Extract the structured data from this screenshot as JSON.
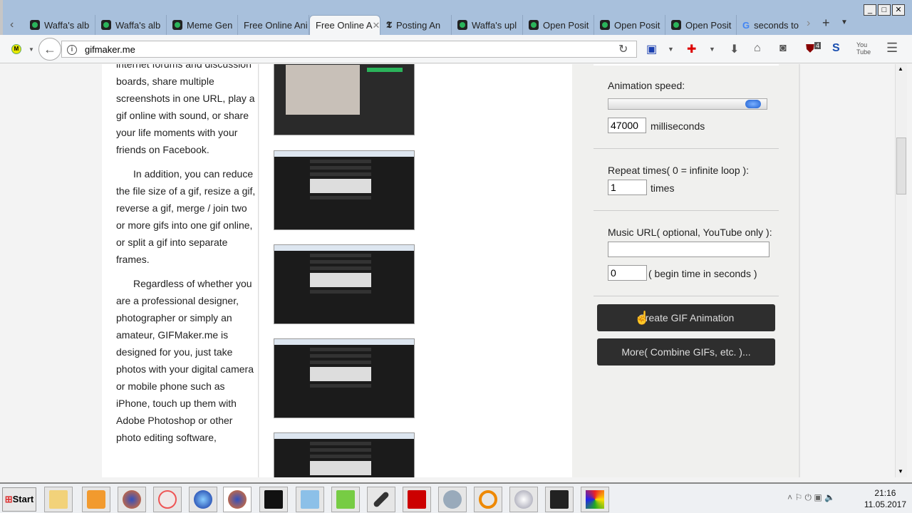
{
  "browser": {
    "tabs": [
      {
        "title": "Waffa's alb",
        "icon": "green-square"
      },
      {
        "title": "Waffa's alb",
        "icon": "green-square"
      },
      {
        "title": "Meme Gen",
        "icon": "green-square"
      },
      {
        "title": "Free Online Ani",
        "icon": "none"
      },
      {
        "title": "Free Online A",
        "icon": "none",
        "active": true
      },
      {
        "title": "Posting An",
        "icon": "nyt-t"
      },
      {
        "title": "Waffa's upl",
        "icon": "green-square"
      },
      {
        "title": "Open Posit",
        "icon": "green-square"
      },
      {
        "title": "Open Posit",
        "icon": "green-square"
      },
      {
        "title": "Open Posit",
        "icon": "green-square"
      },
      {
        "title": "seconds to",
        "icon": "google-g"
      }
    ],
    "url": "gifmaker.me",
    "ublock_badge": "4"
  },
  "article": {
    "paragraphs": [
      "internet forums and discussion boards, share multiple screenshots in one URL, play a gif online with sound, or share your life moments with your friends on Facebook.",
      "In addition, you can reduce the file size of a gif, resize a gif, reverse a gif, merge / join two or more gifs into one gif online, or split a gif into separate frames.",
      "Regardless of whether you are a professional designer, photographer or simply an amateur, GIFMaker.me is designed for you, just take photos with your digital camera or mobile phone such as iPhone, touch up them with Adobe Photoshop or other photo editing software,"
    ]
  },
  "settings": {
    "speed_label": "Animation speed:",
    "speed_slider_fraction": 0.96,
    "speed_value": "47000",
    "speed_unit": "milliseconds",
    "repeat_label": "Repeat times( 0 = infinite loop ):",
    "repeat_value": "1",
    "repeat_unit": "times",
    "music_label": "Music URL( optional, YouTube only ):",
    "music_value": "",
    "begin_value": "0",
    "begin_unit": "( begin time in seconds )",
    "create_button": "Create GIF Animation",
    "more_button": "More( Combine GIFs, etc. )..."
  },
  "taskbar": {
    "start": "Start",
    "time": "21:16",
    "date": "11.05.2017"
  }
}
